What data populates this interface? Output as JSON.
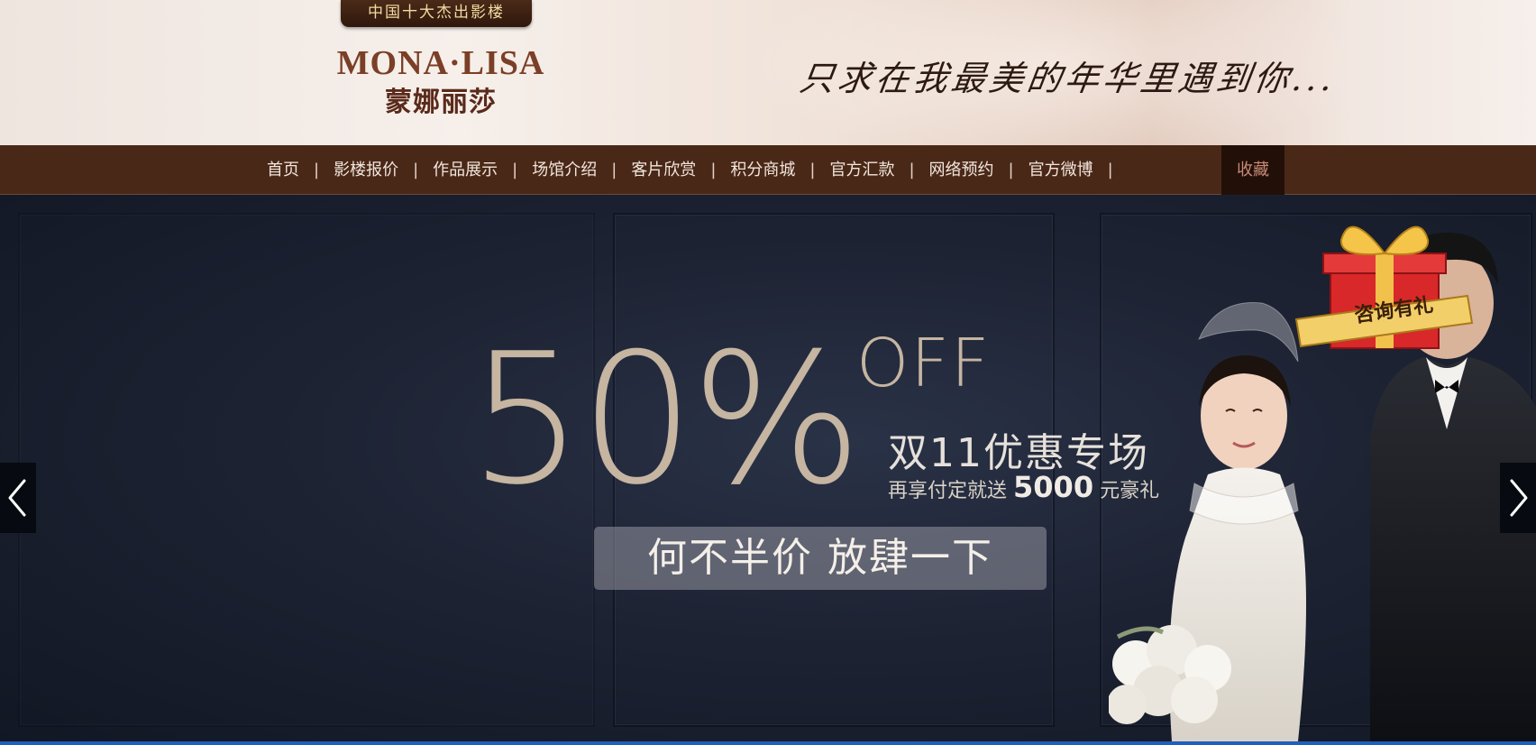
{
  "header": {
    "badge": "中国十大杰出影楼",
    "logo_en": "MONA·LISA",
    "logo_cn": "蒙娜丽莎",
    "slogan": "只求在我最美的年华里遇到你..."
  },
  "nav": {
    "items": [
      "首页",
      "影楼报价",
      "作品展示",
      "场馆介绍",
      "客片欣赏",
      "积分商城",
      "官方汇款",
      "网络预约",
      "官方微博"
    ],
    "separator": "|",
    "favorite": "收藏"
  },
  "banner": {
    "percent": "50%",
    "off": "OFF",
    "title": "双11优惠专场",
    "sub_prefix": "再享付定就送",
    "sub_amount": "5000",
    "sub_suffix": "元豪礼",
    "cta": "何不半价 放肆一下",
    "gift_label": "咨询有礼"
  },
  "colors": {
    "nav_bg": "#4a2818",
    "banner_bg": "#1d2333",
    "promo_text": "#c5b5a1",
    "accent_line": "#1e5fbf"
  },
  "icons": {
    "prev": "chevron-left-icon",
    "next": "chevron-right-icon",
    "gift": "gift-box-icon"
  }
}
